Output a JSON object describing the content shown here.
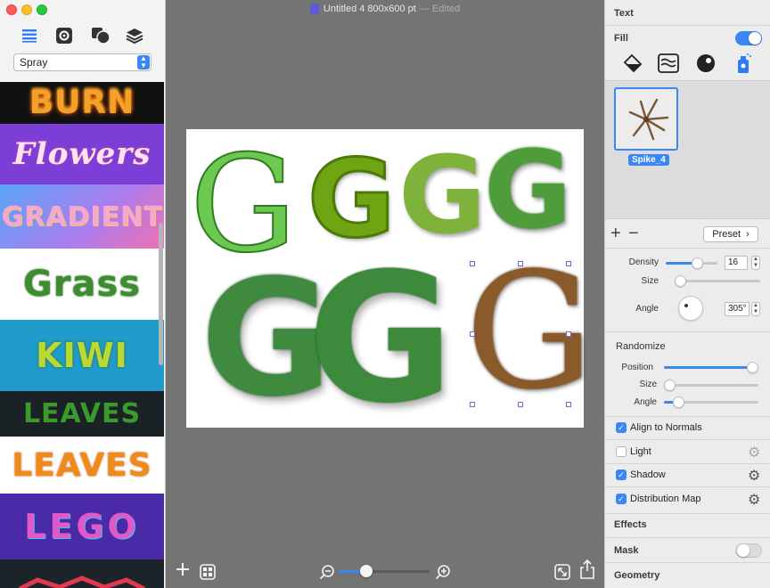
{
  "window": {
    "title": "Untitled 4 800x600 pt",
    "edited": "— Edited"
  },
  "sidebar": {
    "tools": [
      "list-icon",
      "settings-icon",
      "shapes-icon",
      "layers-icon"
    ],
    "category": "Spray",
    "presets": [
      {
        "label": "BURN"
      },
      {
        "label": "Flowers"
      },
      {
        "label": "GRADIENT"
      },
      {
        "label": "Grass"
      },
      {
        "label": "KIWI"
      },
      {
        "label": "LEAVES"
      },
      {
        "label": "LEAVES"
      },
      {
        "label": "LEGO"
      }
    ]
  },
  "inspector": {
    "text_header": "Text",
    "fill_label": "Fill",
    "fill_enabled": true,
    "fill_types": [
      "paint-bucket-icon",
      "wave-icon",
      "sphere-icon",
      "spray-can-icon"
    ],
    "brush_name": "Spike_4",
    "preset_button": "Preset",
    "density": {
      "label": "Density",
      "value": "16",
      "fraction": 0.6
    },
    "size": {
      "label": "Size",
      "fraction": 0.05
    },
    "angle": {
      "label": "Angle",
      "value": "305°"
    },
    "randomize_header": "Randomize",
    "rand_position": {
      "label": "Position",
      "fraction": 1.0
    },
    "rand_size": {
      "label": "Size",
      "fraction": 0.03
    },
    "rand_angle": {
      "label": "Angle",
      "fraction": 0.15
    },
    "checks": {
      "align_normals": {
        "label": "Align to Normals",
        "checked": true
      },
      "light": {
        "label": "Light",
        "checked": false
      },
      "shadow": {
        "label": "Shadow",
        "checked": true
      },
      "distribution_map": {
        "label": "Distribution Map",
        "checked": true
      }
    },
    "effects_label": "Effects",
    "mask_label": "Mask",
    "mask_enabled": false,
    "geometry_label": "Geometry"
  },
  "canvas": {
    "zoom_fraction": 0.3,
    "glyphs": [
      "G",
      "G",
      "G",
      "G",
      "G",
      "G",
      "G"
    ]
  },
  "colors": {
    "accent": "#3a86f6",
    "canvas_bg": "#747474"
  }
}
